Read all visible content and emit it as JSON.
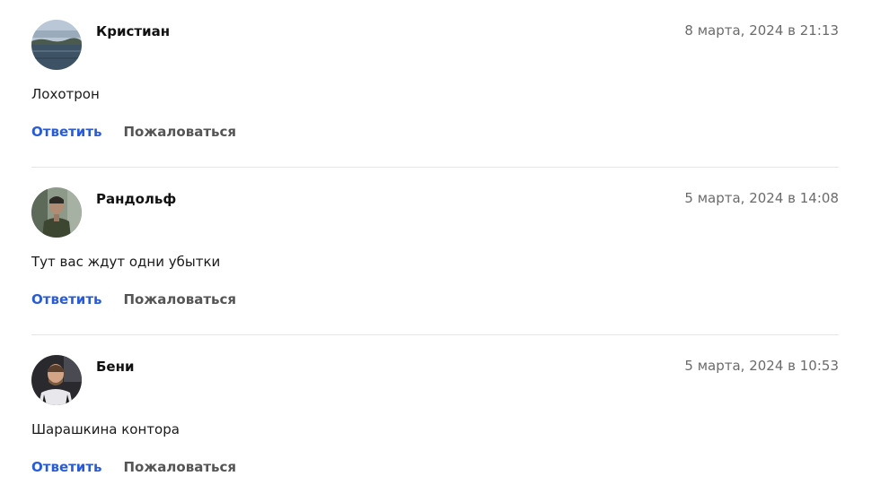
{
  "comments": [
    {
      "author": "Кристиан",
      "date": "8 марта, 2024 в 21:13",
      "text": "Лохотрон",
      "reply_label": "Ответить",
      "complain_label": "Пожаловаться",
      "avatar": "avatar-lake-photo"
    },
    {
      "author": "Рандольф",
      "date": "5 марта, 2024 в 14:08",
      "text": "Тут вас ждут одни убытки",
      "reply_label": "Ответить",
      "complain_label": "Пожаловаться",
      "avatar": "avatar-person-photo"
    },
    {
      "author": "Бени",
      "date": "5 марта, 2024 в 10:53",
      "text": "Шарашкина контора",
      "reply_label": "Ответить",
      "complain_label": "Пожаловаться",
      "avatar": "avatar-person-photo"
    }
  ],
  "colors": {
    "link": "#2a5bd7",
    "secondary_action": "#555555",
    "date": "#6b6b6b",
    "divider": "#e6e6e6"
  }
}
